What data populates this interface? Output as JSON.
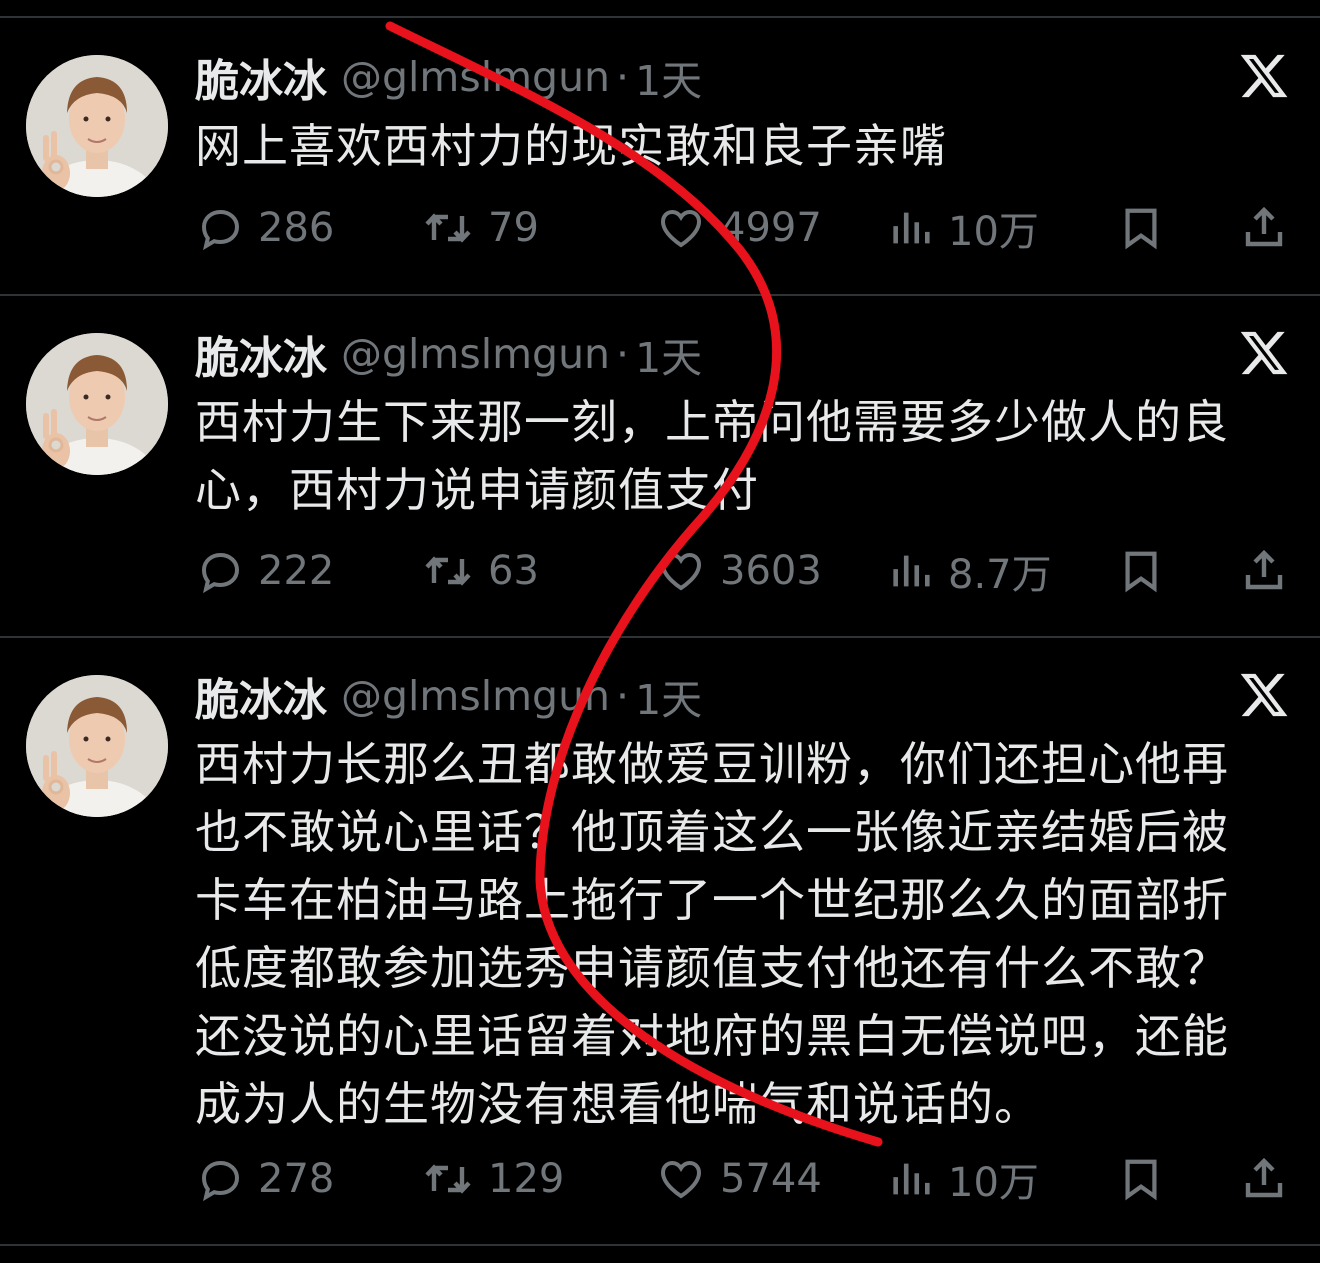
{
  "tweets": [
    {
      "name": "脆冰冰",
      "handle": "@glmslmgun",
      "separator": "·",
      "time": "1天",
      "text": "网上喜欢西村力的现实敢和良子亲嘴",
      "replies": "286",
      "reposts": "79",
      "likes": "4997",
      "views": "10万"
    },
    {
      "name": "脆冰冰",
      "handle": "@glmslmgun",
      "separator": "·",
      "time": "1天",
      "text": "西村力生下来那一刻，上帝问他需要多少做人的良心，西村力说申请颜值支付",
      "replies": "222",
      "reposts": "63",
      "likes": "3603",
      "views": "8.7万"
    },
    {
      "name": "脆冰冰",
      "handle": "@glmslmgun",
      "separator": "·",
      "time": "1天",
      "text": "西村力长那么丑都敢做爱豆训粉，你们还担心他再也不敢说心里话？他顶着这么一张像近亲结婚后被卡车在柏油马路上拖行了一个世纪那么久的面部折低度都敢参加选秀申请颜值支付他还有什么不敢？还没说的心里话留着对地府的黑白无偿说吧，还能成为人的生物没有想看他喘气和说话的。",
      "replies": "278",
      "reposts": "129",
      "likes": "5744",
      "views": "10万"
    }
  ],
  "colors": {
    "background": "#000000",
    "text": "#e7e9ea",
    "secondary": "#71767b",
    "divider": "#2f3336",
    "annotation_line": "#e8121c"
  },
  "icons": [
    "reply-icon",
    "repost-icon",
    "like-icon",
    "views-icon",
    "bookmark-icon",
    "share-icon",
    "x-logo-icon"
  ]
}
